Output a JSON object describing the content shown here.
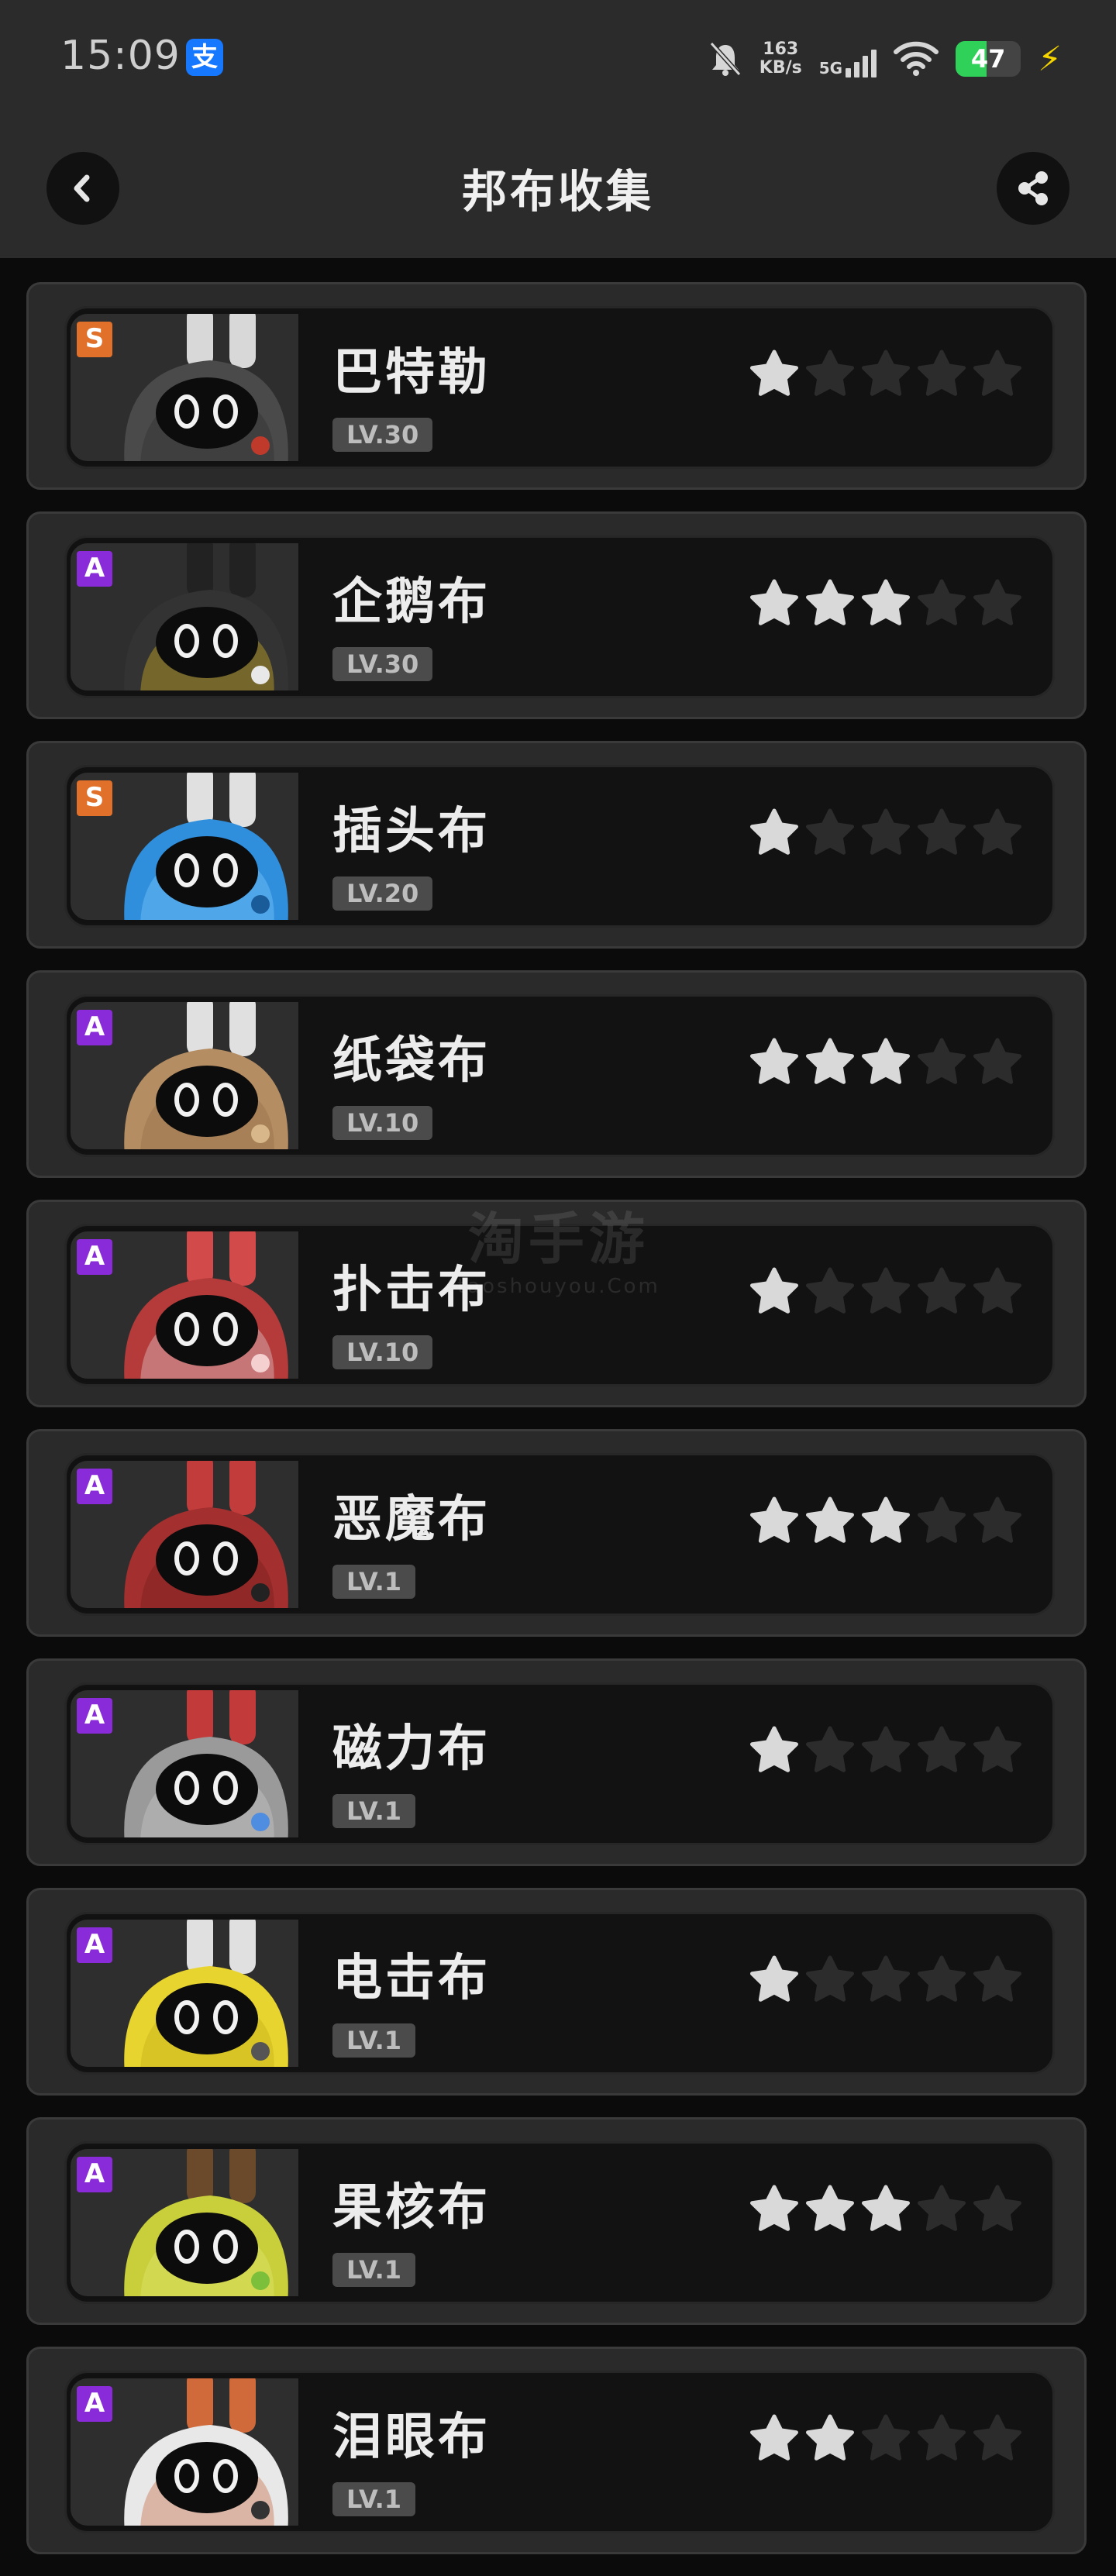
{
  "status": {
    "time": "15:09",
    "alipay": "支",
    "net_speed_value": "163",
    "net_speed_unit": "KB/s",
    "network": "5G",
    "battery": "47",
    "battery_level": 0.47
  },
  "header": {
    "title": "邦布收集"
  },
  "items": [
    {
      "name": "巴特勒",
      "level": "LV.30",
      "rarity": "S",
      "stars": 1,
      "art": "rabbit"
    },
    {
      "name": "企鹅布",
      "level": "LV.30",
      "rarity": "A",
      "stars": 3,
      "art": "penguin"
    },
    {
      "name": "插头布",
      "level": "LV.20",
      "rarity": "S",
      "stars": 1,
      "art": "plug"
    },
    {
      "name": "纸袋布",
      "level": "LV.10",
      "rarity": "A",
      "stars": 3,
      "art": "paperbag"
    },
    {
      "name": "扑击布",
      "level": "LV.10",
      "rarity": "A",
      "stars": 1,
      "art": "pounce"
    },
    {
      "name": "恶魔布",
      "level": "LV.1",
      "rarity": "A",
      "stars": 3,
      "art": "devil"
    },
    {
      "name": "磁力布",
      "level": "LV.1",
      "rarity": "A",
      "stars": 1,
      "art": "magnet"
    },
    {
      "name": "电击布",
      "level": "LV.1",
      "rarity": "A",
      "stars": 1,
      "art": "electro"
    },
    {
      "name": "果核布",
      "level": "LV.1",
      "rarity": "A",
      "stars": 3,
      "art": "fruit"
    },
    {
      "name": "泪眼布",
      "level": "LV.1",
      "rarity": "A",
      "stars": 2,
      "art": "teary"
    }
  ],
  "watermark": {
    "main": "淘手游",
    "sub": "taoshouyou.Com"
  }
}
